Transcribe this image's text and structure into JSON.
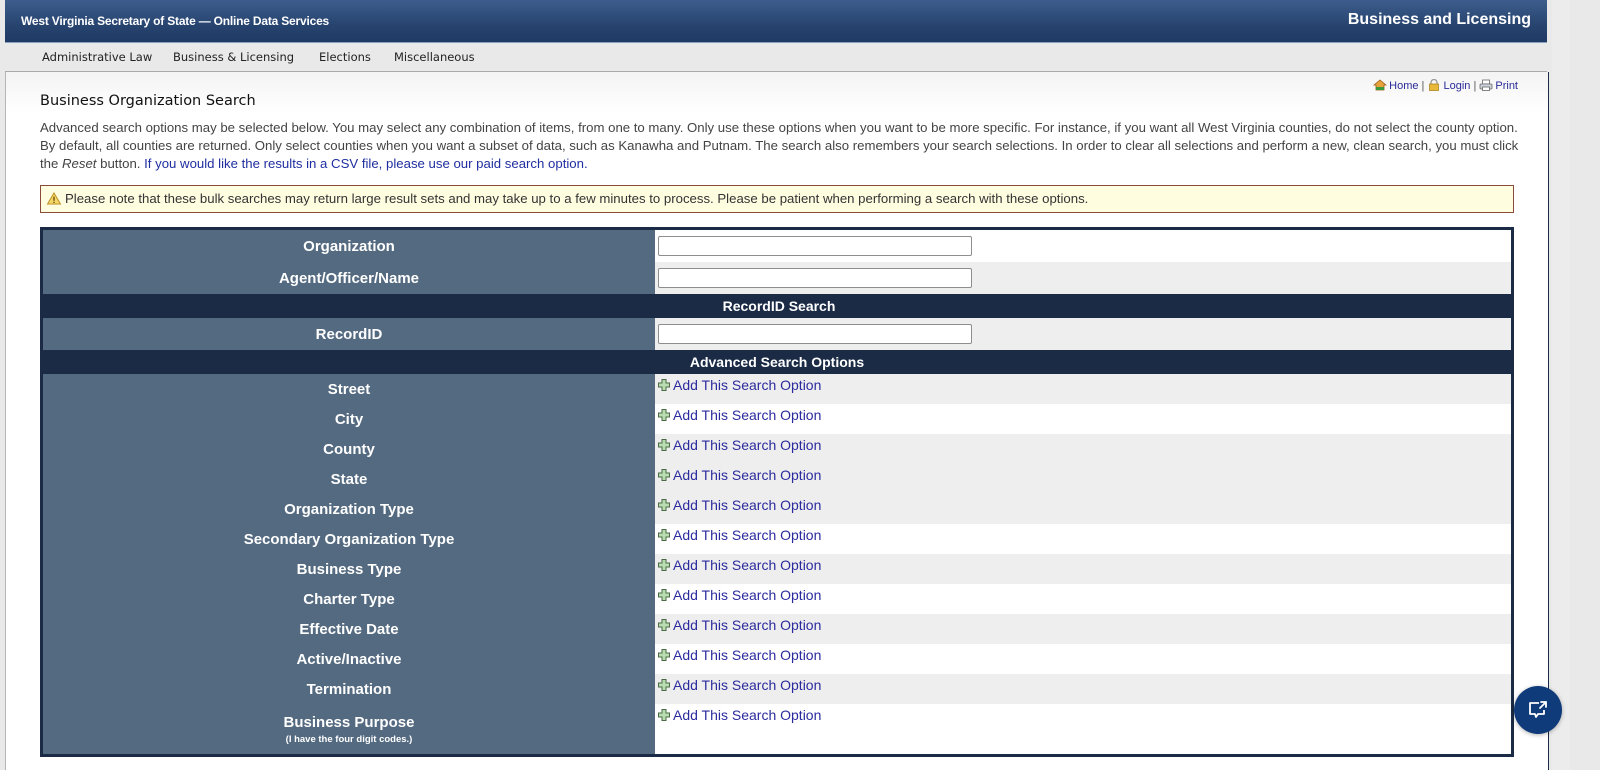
{
  "header": {
    "site_title": "West Virginia Secretary of State — Online Data Services",
    "section_title": "Business and Licensing"
  },
  "nav": {
    "items": [
      {
        "label": "Administrative Law"
      },
      {
        "label": "Business & Licensing"
      },
      {
        "label": "Elections"
      },
      {
        "label": "Miscellaneous"
      }
    ]
  },
  "util_links": {
    "home": "Home",
    "login": "Login",
    "print": "Print",
    "separator": "|"
  },
  "page": {
    "title": "Business Organization Search",
    "intro_part1": "Advanced search options may be selected below. You may select any combination of items, from one to many. Only use these options when you want to be more specific. For instance, if you want all West Virginia counties, do not select the county option. By default, all counties are returned. Only select counties when you want a subset of data, such as Kanawha and Putnam. The search also remembers your search selections. In order to clear all selections and perform a new, clean search, you must click the ",
    "intro_reset_word": "Reset",
    "intro_part2": " button. ",
    "intro_csv_link": "If you would like the results in a CSV file, please use our paid search option.",
    "notice": "Please note that these bulk searches may return large result sets and may take up to a few minutes to process. Please be patient when performing a search with these options."
  },
  "form": {
    "organization": {
      "label": "Organization",
      "value": ""
    },
    "agent": {
      "label": "Agent/Officer/Name",
      "value": ""
    },
    "recordid_section": "RecordID Search",
    "recordid": {
      "label": "RecordID",
      "value": ""
    },
    "advanced_section": "Advanced Search Options",
    "add_option_label": "Add This Search Option",
    "options": [
      {
        "label": "Street"
      },
      {
        "label": "City"
      },
      {
        "label": "County"
      },
      {
        "label": "State"
      },
      {
        "label": "Organization Type"
      },
      {
        "label": "Secondary Organization Type"
      },
      {
        "label": "Business Type"
      },
      {
        "label": "Charter Type"
      },
      {
        "label": "Effective Date"
      },
      {
        "label": "Active/Inactive"
      },
      {
        "label": "Termination"
      },
      {
        "label": "Business Purpose",
        "sublabel": "(I have the four digit codes.)"
      }
    ]
  },
  "colors": {
    "header_blue": "#27446f",
    "label_slate": "#546a80",
    "section_navy": "#1b2b45",
    "link_blue": "#2b2b9e",
    "notice_bg": "#fffde0",
    "chat_button": "#0f3b7a"
  },
  "icons": {
    "home": "home-icon",
    "login": "lock-icon",
    "print": "printer-icon",
    "warning": "warning-icon",
    "add": "plus-icon",
    "chat": "chat-external-icon"
  }
}
